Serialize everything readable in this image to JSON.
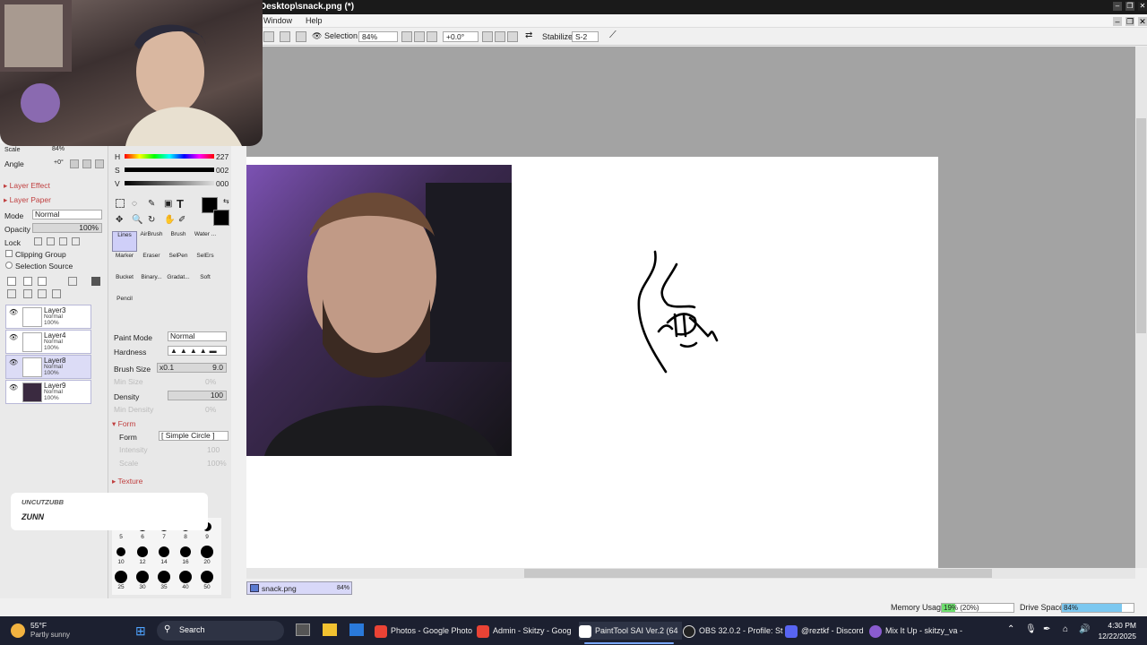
{
  "window": {
    "title": "Desktop\\snack.png (*)"
  },
  "menu": {
    "window": "Window",
    "help": "Help"
  },
  "toolbar": {
    "selection_label": "Selection",
    "zoom": "84%",
    "rotation": "+0.0°",
    "stabilizer_label": "Stabilizer",
    "stabilizer_value": "S-2"
  },
  "navigator": {
    "scale_label": "Scale",
    "scale_value": "84%",
    "angle_label": "Angle",
    "angle_value": "+0°"
  },
  "layer_panel": {
    "layer_effect": "Layer Effect",
    "layer_paper": "Layer Paper",
    "mode_label": "Mode",
    "mode_value": "Normal",
    "opacity_label": "Opacity",
    "opacity_value": "100%",
    "lock_label": "Lock",
    "clipping_group": "Clipping Group",
    "selection_source": "Selection Source",
    "layers": [
      {
        "name": "Layer3",
        "mode": "Normal",
        "opacity": "100%"
      },
      {
        "name": "Layer4",
        "mode": "Normal",
        "opacity": "100%"
      },
      {
        "name": "Layer8",
        "mode": "Normal",
        "opacity": "100%"
      },
      {
        "name": "Layer9",
        "mode": "Normal",
        "opacity": "100%"
      }
    ]
  },
  "color": {
    "h_label": "H",
    "h_value": "227",
    "s_label": "S",
    "s_value": "002",
    "v_label": "V",
    "v_value": "000",
    "primary": "#000000",
    "hue_accent": "#ff0000"
  },
  "tools": {
    "brushes": [
      "Lines",
      "AirBrush",
      "Brush",
      "Water ...",
      "Marker",
      "Eraser",
      "SelPen",
      "SelErs",
      "Bucket",
      "Binary...",
      "Gradat...",
      "Soft",
      "Pencil"
    ]
  },
  "brush_settings": {
    "paint_mode_label": "Paint Mode",
    "paint_mode_value": "Normal",
    "hardness_label": "Hardness",
    "brush_size_label": "Brush Size",
    "brush_size_mult": "x0.1",
    "brush_size_value": "9.0",
    "min_size_label": "Min Size",
    "min_size_value": "0%",
    "density_label": "Density",
    "density_value": "100",
    "min_density_label": "Min Density",
    "min_density_value": "0%",
    "form_section": "Form",
    "form_label": "Form",
    "form_value": "[ Simple Circle ]",
    "intensity_label": "Intensity",
    "intensity_value": "100",
    "scale_label": "Scale",
    "scale_value": "100%",
    "texture_section": "Texture",
    "size_presets": [
      "5",
      "6",
      "7",
      "8",
      "9",
      "10",
      "12",
      "14",
      "16",
      "20",
      "25",
      "30",
      "35",
      "40",
      "50"
    ]
  },
  "chat": {
    "user": "UNCUTZUBB",
    "message": "ZUNN"
  },
  "document_tab": {
    "name": "snack.png",
    "zoom": "84%"
  },
  "status": {
    "memory_label": "Memory Usage",
    "memory_value": "19% (20%)",
    "memory_fraction": 0.19,
    "drive_label": "Drive Space",
    "drive_value": "84%",
    "drive_fraction": 0.84
  },
  "taskbar": {
    "weather_temp": "55°F",
    "weather_desc": "Partly sunny",
    "search": "Search",
    "apps": [
      "Photos - Google Photo",
      "Admin - Skitzy - Goog",
      "PaintTool SAI Ver.2 (64",
      "OBS 32.0.2 - Profile: St",
      "@reztkf - Discord",
      "Mix It Up - skitzy_va -"
    ],
    "time": "4:30 PM",
    "date": "12/22/2025"
  }
}
